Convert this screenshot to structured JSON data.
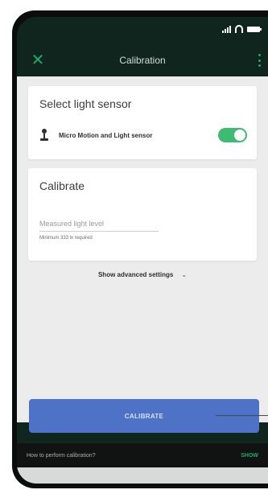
{
  "app": {
    "title": "Calibration"
  },
  "sensor_card": {
    "title": "Select light sensor",
    "sensor_name": "Micro Motion and Light sensor",
    "toggle_on": true
  },
  "calibrate_card": {
    "title": "Calibrate",
    "input_placeholder": "Measured light level",
    "input_value": "",
    "helper_text": "Minimum 333 lx required"
  },
  "advanced": {
    "label": "Show advanced settings"
  },
  "actions": {
    "calibrate_label": "CALIBRATE"
  },
  "snackbar": {
    "text": "How to perform calibration?",
    "action": "SHOW"
  },
  "colors": {
    "accent": "#1fa96a",
    "toggle": "#3dbb73",
    "button": "#4d72c6",
    "appbar": "#10251d"
  }
}
